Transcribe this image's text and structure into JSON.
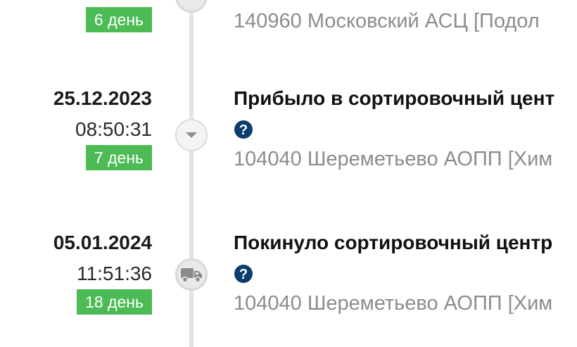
{
  "events": [
    {
      "day_badge": "6 день",
      "location": "140960 Московский АСЦ [Подол"
    },
    {
      "date": "25.12.2023",
      "time": "08:50:31",
      "day_badge": "7 день",
      "status": "Прибыло в сортировочный цент",
      "location": "104040 Шереметьево АОПП [Хим"
    },
    {
      "date": "05.01.2024",
      "time": "11:51:36",
      "day_badge": "18 день",
      "status": "Покинуло сортировочный центр",
      "location": "104040 Шереметьево АОПП [Хим"
    }
  ],
  "icons": {
    "arrival": "chevron-down-icon",
    "departure": "truck-icon",
    "help": "question-circle-icon"
  },
  "colors": {
    "badge": "#4cbb55",
    "help_icon": "#0d3d6e",
    "timeline": "#e3e3e3",
    "location_text": "#8c8c8c"
  }
}
